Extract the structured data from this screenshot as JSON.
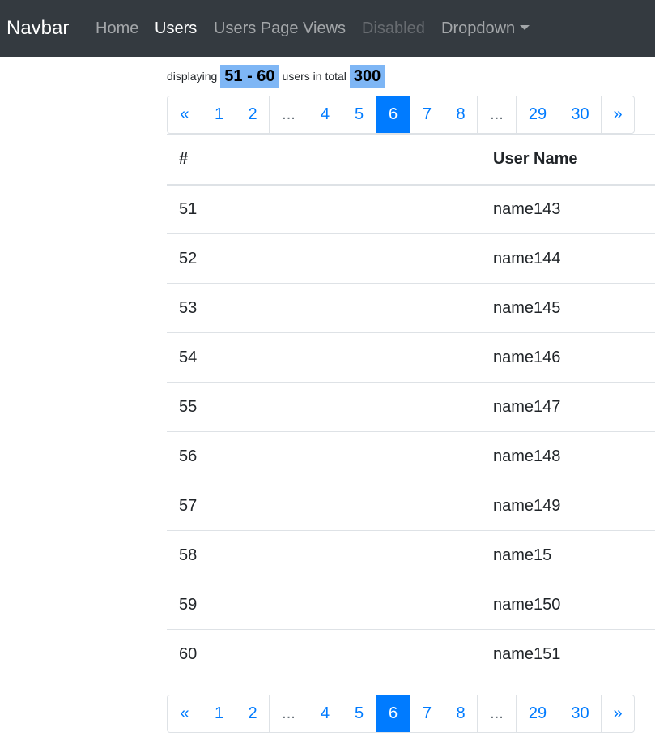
{
  "navbar": {
    "brand": "Navbar",
    "links": [
      {
        "label": "Home"
      },
      {
        "label": "Users"
      },
      {
        "label": "Users Page Views"
      },
      {
        "label": "Disabled"
      },
      {
        "label": "Dropdown"
      }
    ]
  },
  "summary": {
    "prefix": "displaying",
    "range": "51 - 60",
    "middle": "users in total",
    "total": "300"
  },
  "pagination": {
    "prev": "«",
    "next": "»",
    "pages": [
      "1",
      "2",
      "...",
      "4",
      "5",
      "6",
      "7",
      "8",
      "...",
      "29",
      "30"
    ],
    "active": "6"
  },
  "table": {
    "headers": [
      "#",
      "User Name"
    ],
    "rows": [
      [
        "51",
        "name143"
      ],
      [
        "52",
        "name144"
      ],
      [
        "53",
        "name145"
      ],
      [
        "54",
        "name146"
      ],
      [
        "55",
        "name147"
      ],
      [
        "56",
        "name148"
      ],
      [
        "57",
        "name149"
      ],
      [
        "58",
        "name15"
      ],
      [
        "59",
        "name150"
      ],
      [
        "60",
        "name151"
      ]
    ]
  },
  "colors": {
    "navbar_bg": "#343a40",
    "accent": "#007bff",
    "highlight": "#7eb6f5"
  }
}
